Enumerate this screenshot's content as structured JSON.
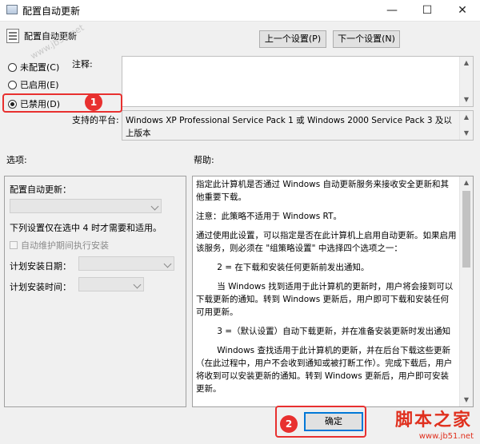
{
  "window": {
    "title": "配置自动更新",
    "minimize": "—",
    "maximize": "☐",
    "close": "✕"
  },
  "header": {
    "policy_name": "配置自动更新",
    "prev_button": "上一个设置(P)",
    "next_button": "下一个设置(N)"
  },
  "state_options": [
    {
      "label": "未配置(C)",
      "checked": false
    },
    {
      "label": "已启用(E)",
      "checked": false
    },
    {
      "label": "已禁用(D)",
      "checked": true
    }
  ],
  "comment": {
    "label": "注释:",
    "value": ""
  },
  "supported": {
    "label": "支持的平台:",
    "value": "Windows XP Professional Service Pack 1 或 Windows 2000 Service Pack 3 及以上版本"
  },
  "options": {
    "section_label": "选项:",
    "config_label": "配置自动更新：",
    "config_value": "",
    "note": "下列设置仅在选中 4 时才需要和适用。",
    "maintenance_checkbox": "自动维护期间执行安装",
    "install_day_label": "计划安装日期：",
    "install_time_label": "计划安装时间："
  },
  "help": {
    "section_label": "帮助:",
    "paragraphs": [
      "指定此计算机是否通过 Windows 自动更新服务来接收安全更新和其他重要下载。",
      "注意：此策略不适用于 Windows RT。",
      "通过使用此设置，可以指定是否在此计算机上启用自动更新。如果启用该服务，则必须在 \"组策略设置\" 中选择四个选项之一：",
      "2 = 在下载和安装任何更新前发出通知。",
      "当 Windows 找到适用于此计算机的更新时，用户将会接到可以下载更新的通知。转到 Windows 更新后，用户即可下载和安装任何可用更新。",
      "3 =（默认设置）自动下载更新，并在准备安装更新时发出通知",
      "Windows 查找适用于此计算机的更新，并在后台下载这些更新（在此过程中，用户不会收到通知或被打断工作）。完成下载后，用户将收到可以安装更新的通知。转到 Windows 更新后，用户即可安装更新。"
    ]
  },
  "footer": {
    "ok_button": "确定"
  },
  "annotations": {
    "badge1": "1",
    "badge2": "2",
    "color": "#e8302f"
  },
  "watermark": {
    "text": "www.jb51.net"
  },
  "brand": {
    "text": "脚本之家",
    "url": "www.jb51.net"
  }
}
